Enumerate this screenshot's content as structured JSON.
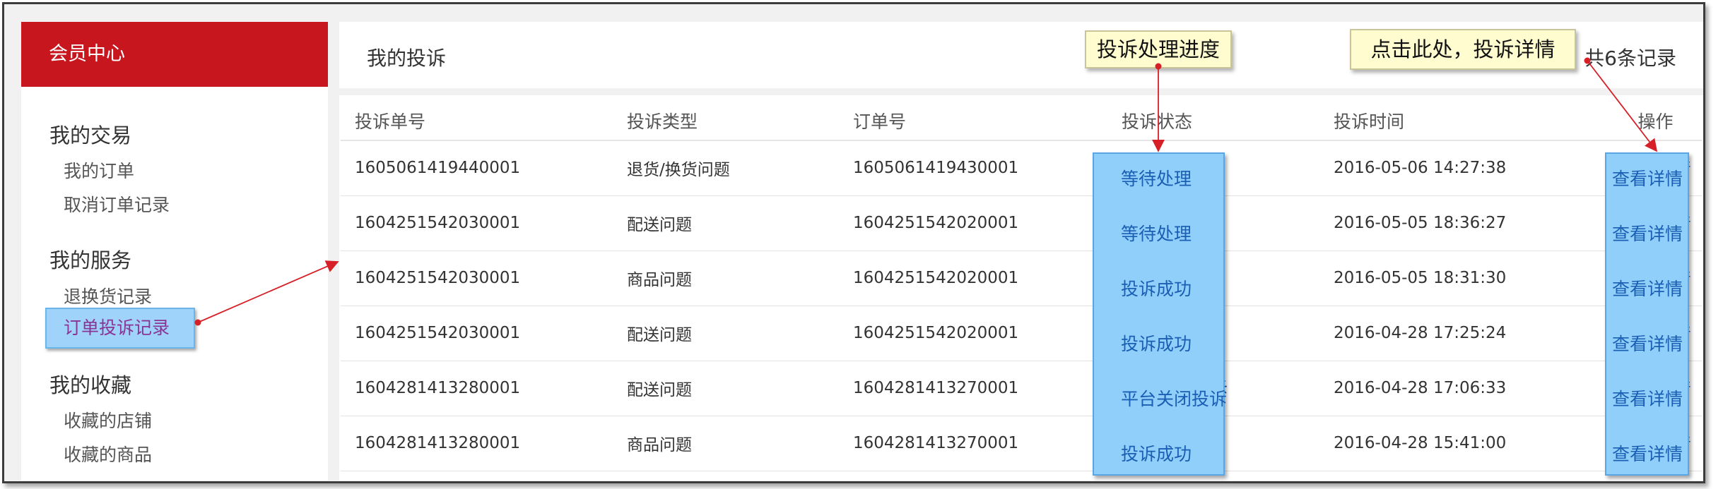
{
  "sidebar": {
    "header": "会员中心",
    "groups": [
      {
        "title": "我的交易",
        "items": [
          "我的订单",
          "取消订单记录"
        ]
      },
      {
        "title": "我的服务",
        "items": [
          "退换货记录",
          "订单投诉记录"
        ]
      },
      {
        "title": "我的收藏",
        "items": [
          "收藏的店铺",
          "收藏的商品"
        ]
      }
    ],
    "active_item": "订单投诉记录"
  },
  "main": {
    "title": "我的投诉",
    "record_count": "共6条记录",
    "columns": [
      "投诉单号",
      "投诉类型",
      "订单号",
      "投诉状态",
      "投诉时间",
      "操作"
    ],
    "rows": [
      {
        "id": "1605061419440001",
        "type": "退货/换货问题",
        "order": "1605061419430001",
        "status": "等待处理",
        "time": "2016-05-06 14:27:38",
        "action": "查看详情"
      },
      {
        "id": "1604251542030001",
        "type": "配送问题",
        "order": "1604251542020001",
        "status": "等待处理",
        "time": "2016-05-05 18:36:27",
        "action": "查看详情"
      },
      {
        "id": "1604251542030001",
        "type": "商品问题",
        "order": "1604251542020001",
        "status": "投诉成功",
        "time": "2016-05-05 18:31:30",
        "action": "查看详情"
      },
      {
        "id": "1604251542030001",
        "type": "配送问题",
        "order": "1604251542020001",
        "status": "投诉成功",
        "time": "2016-04-28 17:25:24",
        "action": "查看详情"
      },
      {
        "id": "1604281413280001",
        "type": "配送问题",
        "order": "1604281413270001",
        "status": "平台关闭投诉",
        "time": "2016-04-28 17:06:33",
        "action": "查看详情"
      },
      {
        "id": "1604281413280001",
        "type": "商品问题",
        "order": "1604281413270001",
        "status": "投诉成功",
        "time": "2016-04-28 15:41:00",
        "action": "查看详情"
      }
    ]
  },
  "callouts": {
    "status": "投诉处理进度",
    "detail": "点击此处，投诉详情"
  },
  "colors": {
    "brand_red": "#c8161e",
    "highlight_blue": "#91cffb",
    "link_blue": "#1b5fb4",
    "callout_bg": "#fffdd0",
    "arrow_red": "#d61f26"
  }
}
